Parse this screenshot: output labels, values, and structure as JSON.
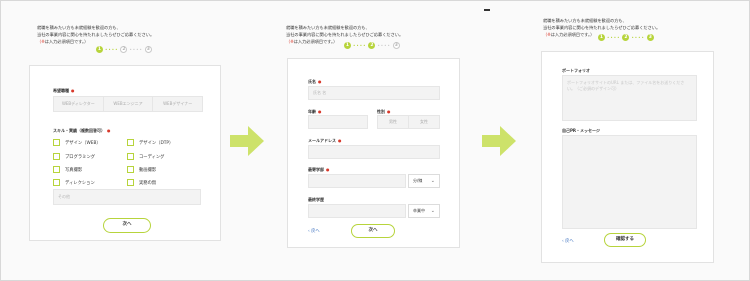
{
  "intro": {
    "line1": "就職を積みたい方も未就経験を歓迎の方も、",
    "line2": "当社の事業内容に関心を持たれましたらぜひご応募ください。",
    "line3_prefix": "（",
    "line3_star": "※",
    "line3_suffix": "は入力必須項目です。）"
  },
  "steps": [
    "1",
    "2",
    "3"
  ],
  "step1": {
    "desired_label": "希望職種",
    "desired_options": [
      "WEBディレクター",
      "WEBエンジニア",
      "WEBデザイナー"
    ],
    "skills_label": "スキル・実績（複数回答可）",
    "skills": [
      "デザイン（WEB）",
      "デザイン（DTP）",
      "プログラミング",
      "コーディング",
      "写真撮影",
      "動画撮影",
      "ディレクション",
      "実務の無"
    ],
    "other_placeholder": "その他",
    "next_label": "次へ"
  },
  "step2": {
    "name_label": "氏名",
    "name_placeholder": "氏名 名",
    "age_label": "年齢",
    "gender_label": "性別",
    "gender_options": [
      "男性",
      "女性"
    ],
    "email_label": "メールアドレス",
    "commute_label": "最寄学部",
    "commute_select": "分/線",
    "school_label": "最終学歴",
    "school_select": "卒業中",
    "back_label": "戻へ",
    "next_label": "次へ"
  },
  "step3": {
    "portfolio_label": "ポートフォリオ",
    "portfolio_placeholder": "ポートフォリオサイトのURL または、ファイル名をお送りください。（ご必須のデザイン可）",
    "message_label": "自己PR・メッセージ",
    "back_label": "戻へ",
    "submit_label": "確認する"
  },
  "colors": {
    "accent": "#b7d43c",
    "required": "#d8392b",
    "link": "#3a6fbf"
  }
}
